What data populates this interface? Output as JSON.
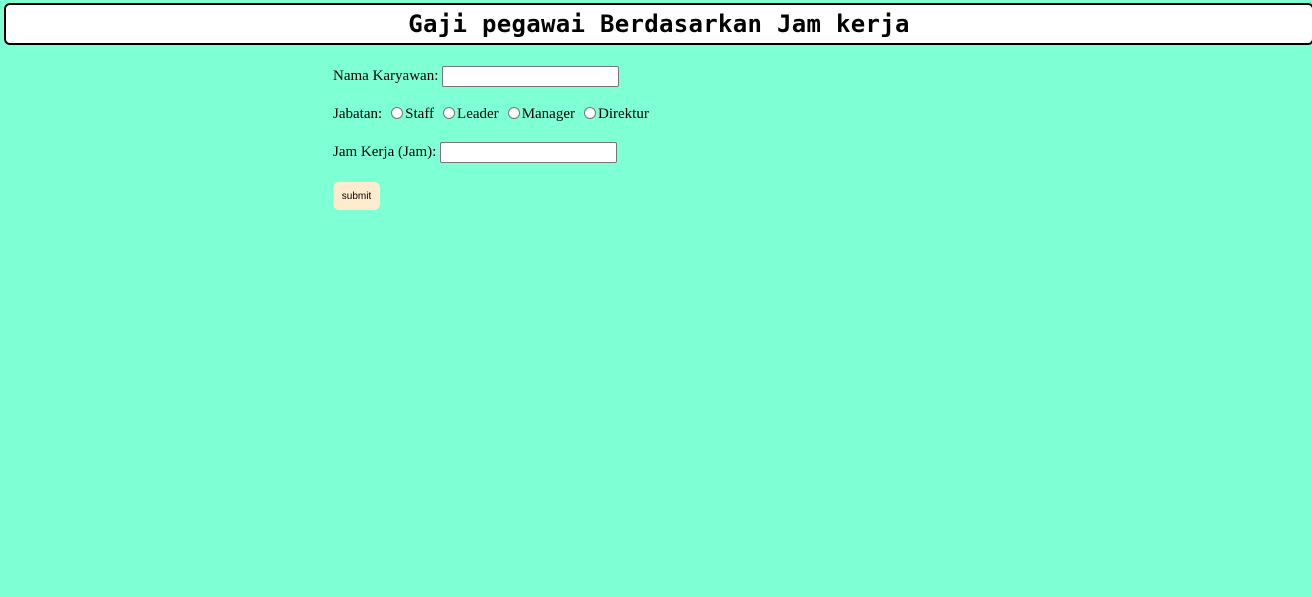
{
  "header": {
    "title": "Gaji pegawai Berdasarkan Jam kerja"
  },
  "form": {
    "nama_label": "Nama Karyawan:",
    "nama_value": "",
    "jabatan_label": "Jabatan:",
    "jabatan_options": [
      "Staff",
      "Leader",
      "Manager",
      "Direktur"
    ],
    "jam_label": "Jam Kerja (Jam):",
    "jam_value": "",
    "submit_label": "submit"
  },
  "colors": {
    "background": "#7fffd4",
    "header_bg": "#ffffff",
    "button_bg": "#ffebcd"
  }
}
